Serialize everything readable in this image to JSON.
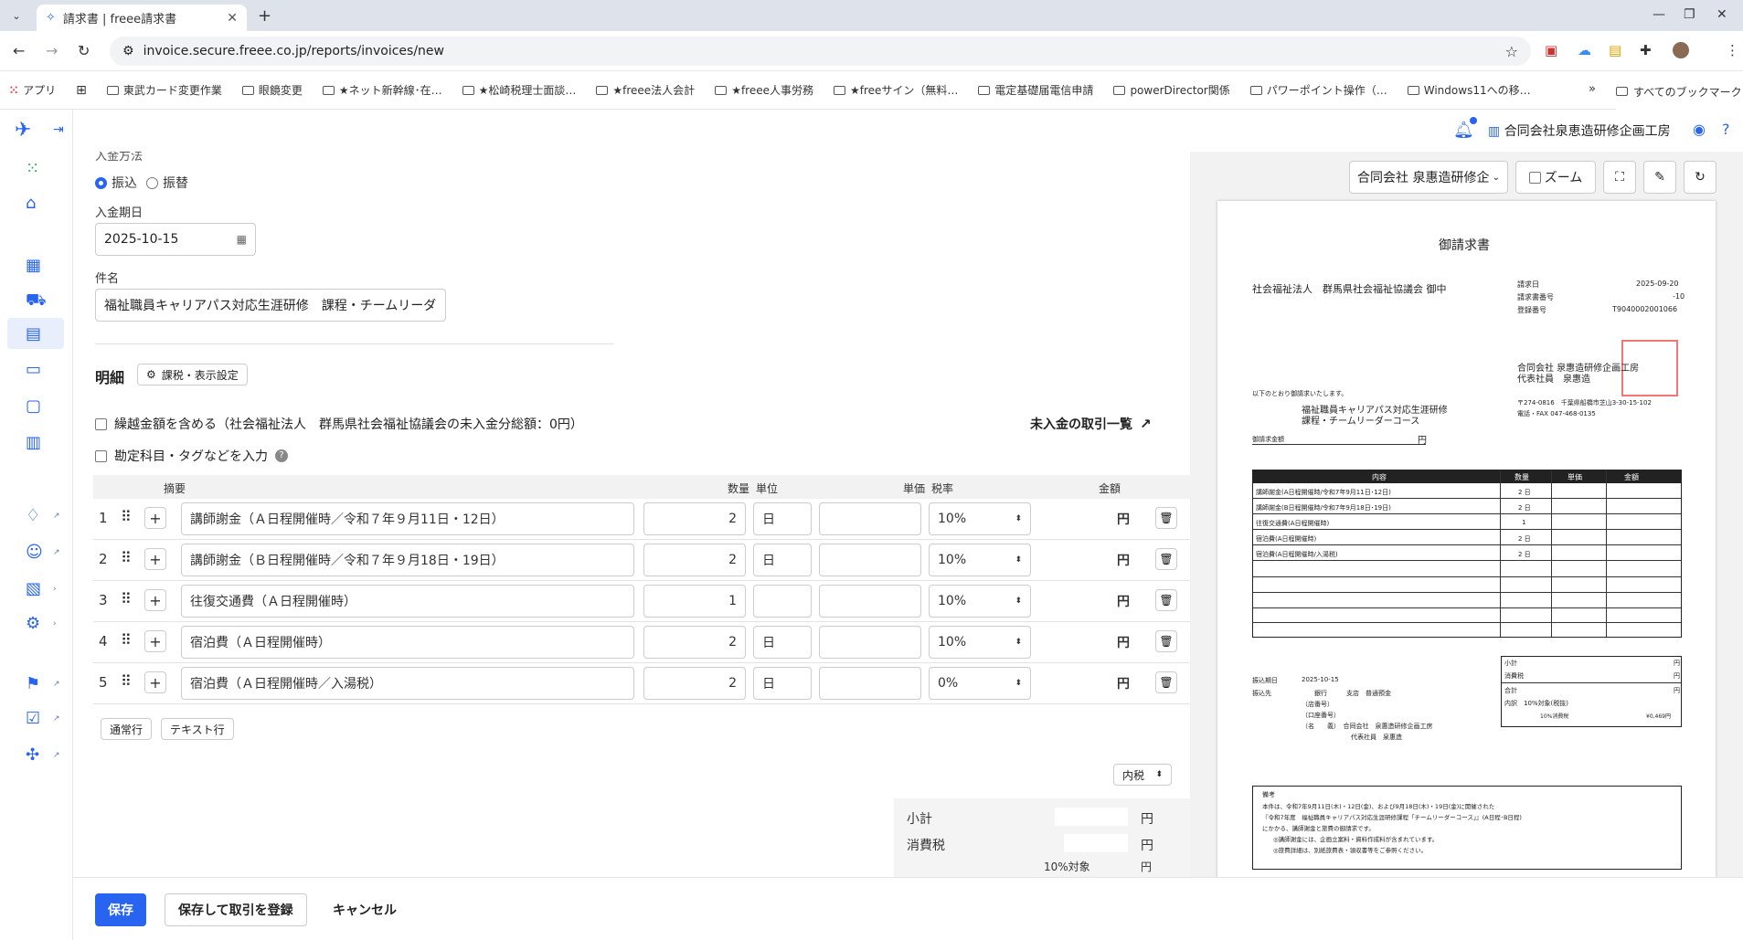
{
  "browser": {
    "tab_title": "請求書 | freee請求書",
    "url": "invoice.secure.freee.co.jp/reports/invoices/new",
    "bookmarks": [
      "アプリ",
      "東武カード変更作業",
      "眼鏡変更",
      "★ネット新幹線･在…",
      "★松崎税理士面談…",
      "★freee法人会計",
      "★freee人事労務",
      "★freeサイン（無料…",
      "電定基礎届電信申請",
      "powerDirector関係",
      "パワーポイント操作（…",
      "Windows11への移…"
    ],
    "bookmarks_all": "すべてのブックマーク"
  },
  "header": {
    "company": "合同会社泉恵造研修企画工房"
  },
  "form": {
    "payment_method_label": "入金方法",
    "payment_option_transfer": "振込",
    "payment_option_furikae": "振替",
    "due_date_label": "入金期日",
    "due_date": "2025-10-15",
    "subject_label": "件名",
    "subject": "福祉職員キャリアパス対応生涯研修　課程・チームリーダ"
  },
  "details": {
    "title": "明細",
    "tax_settings_button": "課税・表示設定",
    "carry_over_label": "繰越金額を含める（社会福祉法人　群馬県社会福祉協議会の未入金分総額：0円）",
    "unpaid_link": "未入金の取引一覧",
    "account_tag_label": "勘定科目・タグなどを入力",
    "columns": {
      "summary": "摘要",
      "qty": "数量",
      "unit": "単位",
      "price": "単価",
      "tax": "税率",
      "amount": "金額"
    },
    "rows": [
      {
        "no": "1",
        "summary": "講師謝金（Ａ日程開催時／令和７年９月11日・12日）",
        "qty": "2",
        "unit": "日",
        "tax": "10%",
        "yen": "円"
      },
      {
        "no": "2",
        "summary": "講師謝金（Ｂ日程開催時／令和７年９月18日・19日）",
        "qty": "2",
        "unit": "日",
        "tax": "10%",
        "yen": "円"
      },
      {
        "no": "3",
        "summary": "往復交通費（Ａ日程開催時）",
        "qty": "1",
        "unit": "",
        "tax": "10%",
        "yen": "円"
      },
      {
        "no": "4",
        "summary": "宿泊費（Ａ日程開催時）",
        "qty": "2",
        "unit": "日",
        "tax": "10%",
        "yen": "円"
      },
      {
        "no": "5",
        "summary": "宿泊費（Ａ日程開催時／入湯税）",
        "qty": "2",
        "unit": "日",
        "tax": "0%",
        "yen": "円"
      }
    ],
    "add_normal_row": "通常行",
    "add_text_row": "テキスト行",
    "tax_mode": "内税",
    "subtotal_label": "小計",
    "tax_label": "消費税",
    "tax10_label": "10%対象",
    "yen": "円"
  },
  "footer": {
    "save": "保存",
    "save_and_register": "保存して取引を登録",
    "cancel": "キャンセル"
  },
  "preview": {
    "company_select": "合同会社 泉惠造研修企画",
    "zoom_label": "ズーム",
    "doc": {
      "title": "御請求書",
      "recipient": "社会福祉法人　群馬県社会福祉協議会 御中",
      "meta_labels": [
        "請求日",
        "請求書番号",
        "登録番号"
      ],
      "meta_values": [
        "2025-09-20",
        "-10",
        "T9040002001066"
      ],
      "issuer": "合同会社 泉惠造研修企画工房",
      "issuer_rep": "代表社員　泉惠造",
      "issuer_zip": "〒274-0816　千葉県船橋市芝山3-30-15-102",
      "issuer_tel": "電話・FAX 047-468-0135",
      "intro": "以下のとおり御請求いたします。",
      "subject1": "福祉職員キャリアパス対応生涯研修",
      "subject2": "課程・チームリーダーコース",
      "amount_label": "御請求金額",
      "amount_yen": "円",
      "tbl_headers": [
        "内容",
        "数量",
        "単価",
        "金額"
      ],
      "tbl_rows": [
        [
          "講師謝金(A日程開催時/令和7年9月11日･12日)",
          "2 日"
        ],
        [
          "講師謝金(B日程開催時/令和7年9月18日･19日)",
          "2 日"
        ],
        [
          "往復交通費(A日程開催時)",
          "1"
        ],
        [
          "宿泊費(A日程開催時)",
          "2 日"
        ],
        [
          "宿泊費(A日程開催時/入湯税)",
          "2 日"
        ]
      ],
      "due_label": "振込期日",
      "due_value": "2025-10-15",
      "bank_label": "振込先",
      "bank_lines": [
        "銀行　　　支店　普通預金",
        "（店番号）",
        "（口座番号）",
        "（名　　義）　合同会社　泉惠造研修企画工房",
        "代表社員　泉惠造"
      ],
      "sum_labels": [
        "小計",
        "消費税",
        "合計",
        "内訳　10%対象(税抜)",
        "10%消費税"
      ],
      "sum_yen": [
        "円",
        "円",
        "円"
      ],
      "sum_tax_value": "¥0,469円",
      "notes_label": "備考",
      "notes": [
        "本件は、令和7年9月11日(木)・12日(金)、および9月18日(木)・19日(金)に開催された",
        "『令和7年度　福祉職員キャリアパス対応生涯研修課程「チームリーダーコース」』(A日程･B日程)",
        "にかかる、講師謝金と旅費の御請求です。",
        "◎講師謝金には、企画立案料・資料作成料が含まれています。",
        "◎旅費詳細は、別紙旅費表・領収書等をご参照ください。"
      ]
    }
  },
  "colors": {
    "accent": "#2864f0",
    "bg_tab": "#dee3eb"
  }
}
